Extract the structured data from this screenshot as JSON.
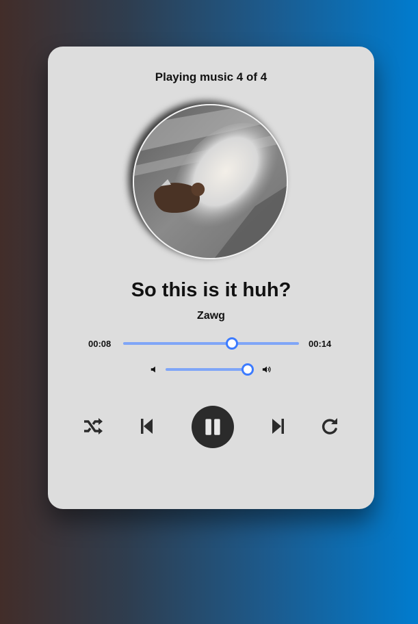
{
  "player": {
    "playing_label": "Playing music 4 of 4",
    "song_title": "So this is it huh?",
    "artist": "Zawg"
  },
  "progress": {
    "current_time": "00:08",
    "total_time": "00:14",
    "fraction": 0.62
  },
  "volume": {
    "fraction": 1.0
  },
  "controls": {
    "shuffle": "shuffle-icon",
    "previous": "skip-previous-icon",
    "play_pause": "pause-icon",
    "next": "skip-next-icon",
    "repeat": "repeat-icon"
  },
  "colors": {
    "slider_track": "#7fa5f7",
    "slider_thumb_border": "#3c7bff",
    "play_button": "#2b2b2b",
    "card": "#dddddd"
  }
}
